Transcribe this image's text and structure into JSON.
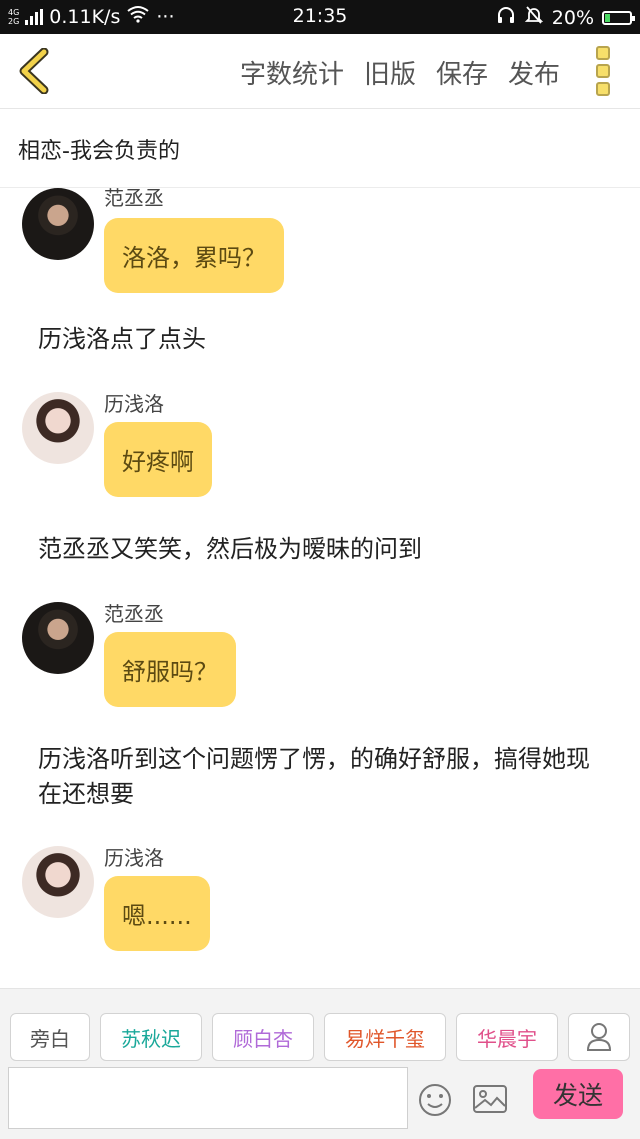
{
  "status_bar": {
    "network_top": "4G",
    "network_bottom": "2G",
    "speed": "0.11K/s",
    "dots": "···",
    "time": "21:35",
    "battery": "20%",
    "battery_level": 0.2
  },
  "toolbar": {
    "word_count": "字数统计",
    "old_version": "旧版",
    "save": "保存",
    "publish": "发布"
  },
  "story_title": "相恋-我会负责的",
  "messages": [
    {
      "type": "dialog",
      "speaker": "范丞丞",
      "text": "洛洛，累吗？",
      "avatar": "male-avatar"
    },
    {
      "type": "narration",
      "text": "历浅洛点了点头"
    },
    {
      "type": "dialog",
      "speaker": "历浅洛",
      "text": "好疼啊",
      "avatar": "female-avatar"
    },
    {
      "type": "narration",
      "text": "范丞丞又笑笑，然后极为暧昧的问到"
    },
    {
      "type": "dialog",
      "speaker": "范丞丞",
      "text": "舒服吗？",
      "avatar": "male-avatar"
    },
    {
      "type": "narration",
      "text": "历浅洛听到这个问题愣了愣，的确好舒服，搞得她现在还想要"
    },
    {
      "type": "dialog",
      "speaker": "历浅洛",
      "text": "嗯......",
      "avatar": "female-avatar"
    }
  ],
  "roles": [
    {
      "label": "旁白",
      "color": "#555555"
    },
    {
      "label": "苏秋迟",
      "color": "#1aa89a"
    },
    {
      "label": "顾白杏",
      "color": "#b06ad8"
    },
    {
      "label": "易烊千玺",
      "color": "#e0562a"
    },
    {
      "label": "华晨宇",
      "color": "#e0508a"
    }
  ],
  "input": {
    "value": "",
    "placeholder": ""
  },
  "send_label": "发送",
  "colors": {
    "bubble": "#ffd966",
    "send": "#ff6fa6",
    "accent": "#f7df6a"
  }
}
